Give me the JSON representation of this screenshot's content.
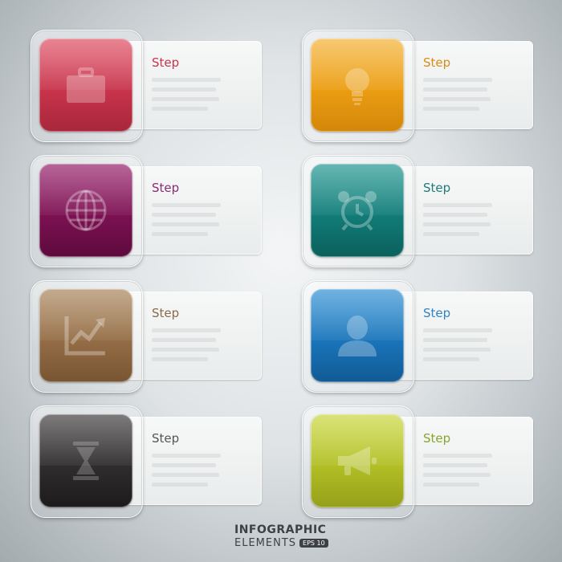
{
  "steps": [
    {
      "label": "Step",
      "color": "#c8344b",
      "label_color": "#c8344b",
      "icon": "briefcase-icon"
    },
    {
      "label": "Step",
      "color": "#eb9d12",
      "label_color": "#d98b18",
      "icon": "lightbulb-icon"
    },
    {
      "label": "Step",
      "color": "#7c1152",
      "label_color": "#8a2a7a",
      "icon": "globe-icon"
    },
    {
      "label": "Step",
      "color": "#127c78",
      "label_color": "#1f7b78",
      "icon": "alarm-clock-icon"
    },
    {
      "label": "Step",
      "color": "#946d45",
      "label_color": "#8a6a4a",
      "icon": "growth-chart-icon"
    },
    {
      "label": "Step",
      "color": "#1a75ba",
      "label_color": "#2f86c4",
      "icon": "user-icon"
    },
    {
      "label": "Step",
      "color": "#2f2d2e",
      "label_color": "#555555",
      "icon": "hourglass-icon"
    },
    {
      "label": "Step",
      "color": "#b2bf25",
      "label_color": "#8aa52c",
      "icon": "megaphone-icon"
    }
  ],
  "footer": {
    "title": "INFOGRAPHIC",
    "subtitle": "ELEMENTS",
    "badge": "EPS 10"
  }
}
